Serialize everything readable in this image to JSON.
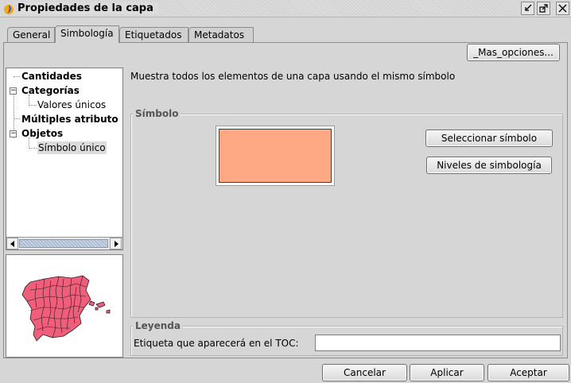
{
  "window": {
    "title": "Propiedades de la capa",
    "icon": "gvsig-logo-icon"
  },
  "tabs": [
    {
      "label": "General"
    },
    {
      "label": "Simbología",
      "active": true
    },
    {
      "label": "Etiquetados"
    },
    {
      "label": "Metadatos"
    }
  ],
  "toolbar": {
    "more_options": "_Mas_opciones..."
  },
  "tree": {
    "items": [
      {
        "label": "Cantidades",
        "bold": true
      },
      {
        "label": "Categorías",
        "bold": true,
        "expanded": true
      },
      {
        "label": "Valores únicos",
        "bold": false
      },
      {
        "label": "Múltiples atributo",
        "bold": true
      },
      {
        "label": "Objetos",
        "bold": true,
        "expanded": true
      },
      {
        "label": "Símbolo único",
        "bold": false,
        "selected": true
      }
    ]
  },
  "description": "Muestra todos los elementos de una capa usando el mismo símbolo",
  "symbol": {
    "legend": "Símbolo",
    "fill_color": "#ffa883",
    "select_button": "Seleccionar símbolo",
    "levels_button": "Niveles de simbología"
  },
  "legend_group": {
    "legend": "Leyenda",
    "toc_label": "Etiqueta que aparecerá en el TOC:",
    "toc_value": ""
  },
  "map_preview": {
    "fill_color": "#ef5f7b"
  },
  "footer": {
    "cancel": "Cancelar",
    "apply": "Aplicar",
    "accept": "Aceptar"
  }
}
